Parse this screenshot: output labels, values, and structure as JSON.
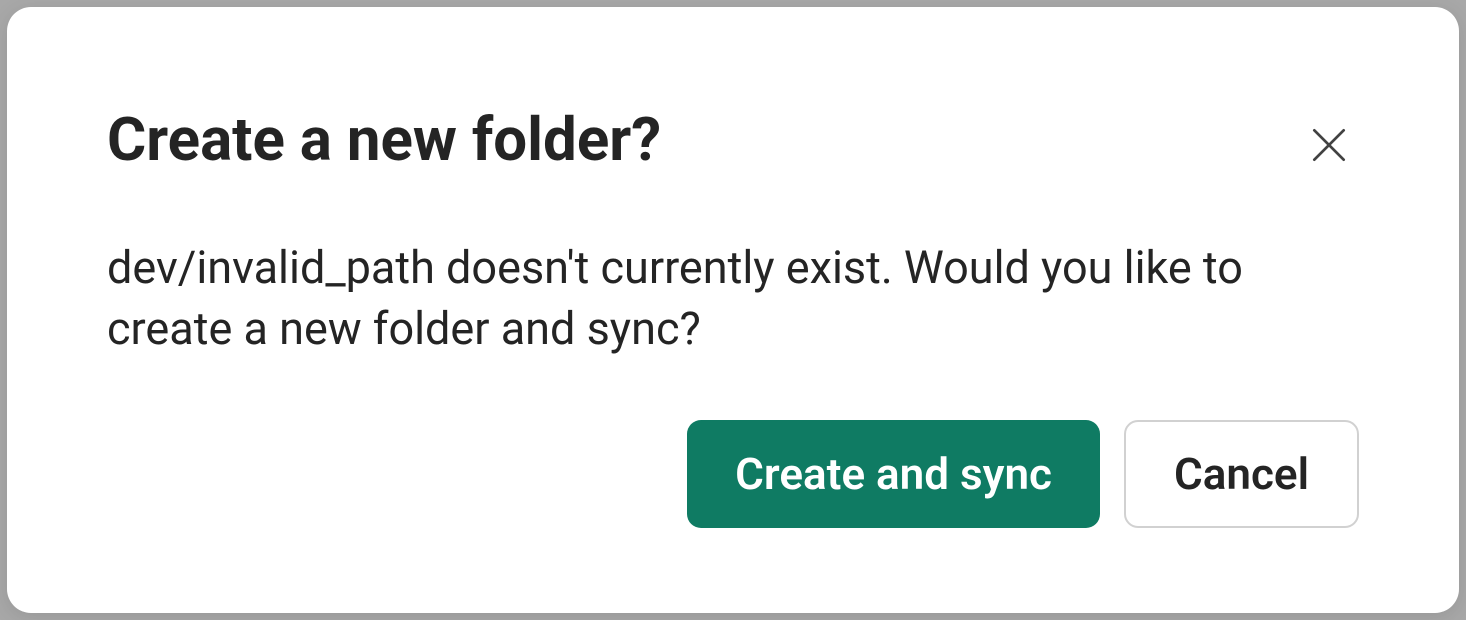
{
  "dialog": {
    "title": "Create a new folder?",
    "body": "dev/invalid_path doesn't currently exist. Would you like to create a new folder and sync?",
    "primary_button": "Create and sync",
    "secondary_button": "Cancel"
  }
}
